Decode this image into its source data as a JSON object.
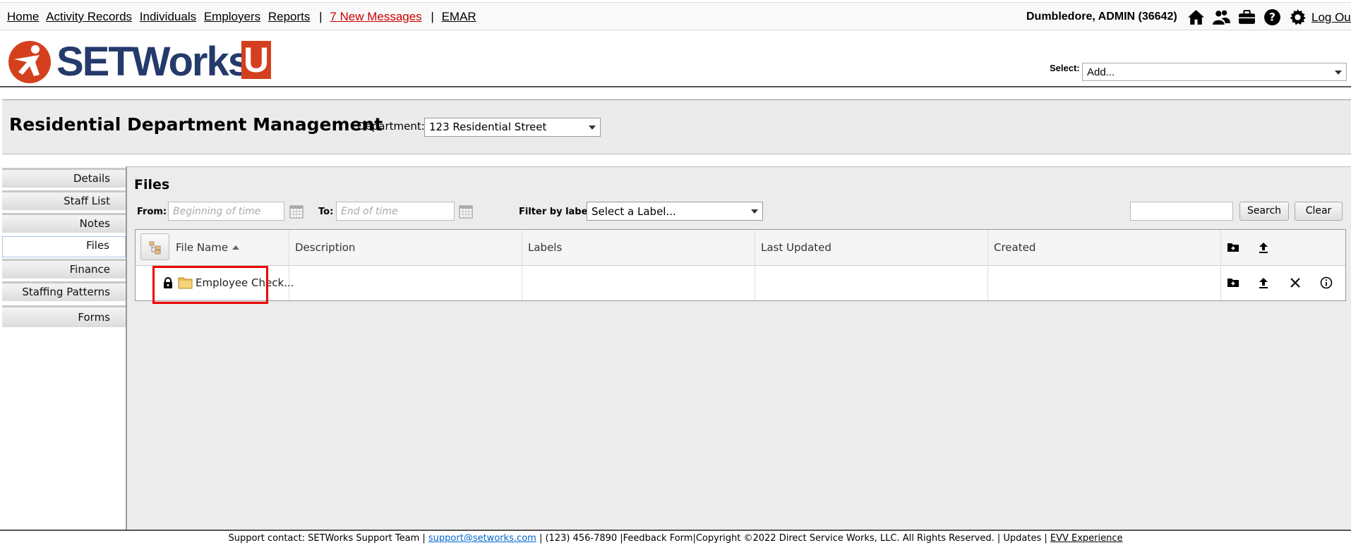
{
  "topnav": {
    "links": [
      "Home",
      "Activity Records",
      "Individuals",
      "Employers",
      "Reports"
    ],
    "messages": "7 New Messages",
    "emar": "EMAR",
    "separator": "|",
    "user": "Dumbledore, ADMIN  (36642)",
    "logout": "Log Out"
  },
  "brand": {
    "logo_text": "SETWorks",
    "logo_u": "U",
    "select_label": "Select:",
    "select_value": "Add..."
  },
  "dept": {
    "title": "Residential Department Management",
    "dept_label": "Department:",
    "dept_value": "123 Residential Street"
  },
  "sidebar": {
    "items": [
      "Details",
      "Staff List",
      "Notes",
      "Files",
      "Finance",
      "Staffing Patterns",
      "Forms"
    ],
    "active": "Files"
  },
  "files": {
    "title": "Files",
    "from_label": "From:",
    "from_placeholder": "Beginning of time",
    "to_label": "To:",
    "to_placeholder": "End of time",
    "filter_label": "Filter by label:",
    "filter_value": "Select a Label...",
    "search_button": "Search",
    "clear_button": "Clear",
    "columns": [
      "File Name",
      "Description",
      "Labels",
      "Last Updated",
      "Created"
    ],
    "rows": [
      {
        "name": "Employee Check...",
        "description": "",
        "labels": "",
        "last_updated": "",
        "created": ""
      }
    ]
  },
  "footer": {
    "support": "Support contact: SETWorks Support Team | ",
    "email": "support@setworks.com",
    "rest": " | (123) 456-7890 |Feedback Form|Copyright ©2022 Direct Service Works, LLC. All Rights Reserved.  |  Updates  |  ",
    "evv": "EVV Experience"
  },
  "colors": {
    "accent": "#d4401e",
    "brand_blue": "#243a6b",
    "link_red": "#cc0000",
    "highlight": "#ee0000"
  }
}
